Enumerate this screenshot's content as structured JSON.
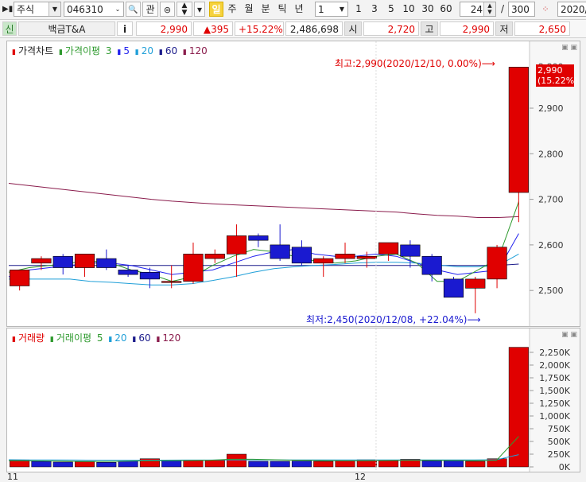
{
  "toolbar": {
    "market_type": "주식",
    "stock_code": "046310",
    "search_button": "🔍",
    "related_button": "관",
    "period_buttons": [
      "일",
      "주",
      "월",
      "분",
      "틱",
      "년"
    ],
    "selected_period": "일",
    "interval_value": "1",
    "quick_intervals": [
      "1",
      "3",
      "5",
      "10",
      "30",
      "60"
    ],
    "display_count": "24",
    "separator": "/",
    "total_count": "300",
    "date_field": "2020/"
  },
  "info": {
    "credit_badge": "신",
    "stock_name": "백금T&A",
    "info_button": "i",
    "current_price": "2,990",
    "change": "▲395",
    "change_rate": "+15.22%",
    "volume": "2,486,698",
    "open_label": "시",
    "open_value": "2,720",
    "high_label": "고",
    "high_value": "2,990",
    "low_label": "저",
    "low_value": "2,650"
  },
  "price_panel": {
    "legend_title": "가격차트",
    "legend_ma_title": "가격이평",
    "legend_periods": [
      "3",
      "5",
      "20",
      "60",
      "120"
    ],
    "high_annotation": "최고:2,990(2020/12/10, 0.00%)⟶",
    "low_annotation": "최저:2,450(2020/12/08, +22.04%)⟶",
    "current_tag_price": "2,990",
    "current_tag_rate": "(15.22%)",
    "y_ticks": [
      "2,800",
      "2,900",
      "2,800",
      "2,700",
      "2,600",
      "2,500"
    ]
  },
  "volume_panel": {
    "legend_title": "거래량",
    "legend_ma_title": "거래이평",
    "legend_periods": [
      "5",
      "20",
      "60",
      "120"
    ],
    "y_ticks": [
      "2,250K",
      "2,000K",
      "1,750K",
      "1,500K",
      "1,250K",
      "1,000K",
      "750K",
      "500K",
      "250K",
      "0K"
    ]
  },
  "x_labels": [
    "11",
    "12"
  ],
  "colors": {
    "up": "#e00000",
    "down": "#1a1ad0",
    "ma3": "#2e9a2e",
    "ma5": "#2222ee",
    "ma20": "#1f9fd8",
    "ma60": "#1a1a8a",
    "ma120": "#8a1c4c"
  },
  "chart_data": {
    "type": "candlestick",
    "price": {
      "ylim": [
        2450,
        3000
      ],
      "candles": [
        {
          "o": 2510,
          "h": 2545,
          "l": 2500,
          "c": 2545
        },
        {
          "o": 2560,
          "h": 2575,
          "l": 2545,
          "c": 2570
        },
        {
          "o": 2575,
          "h": 2580,
          "l": 2535,
          "c": 2550
        },
        {
          "o": 2550,
          "h": 2575,
          "l": 2530,
          "c": 2580
        },
        {
          "o": 2570,
          "h": 2590,
          "l": 2545,
          "c": 2550
        },
        {
          "o": 2545,
          "h": 2555,
          "l": 2530,
          "c": 2535
        },
        {
          "o": 2540,
          "h": 2550,
          "l": 2505,
          "c": 2525
        },
        {
          "o": 2520,
          "h": 2555,
          "l": 2505,
          "c": 2520
        },
        {
          "o": 2520,
          "h": 2605,
          "l": 2515,
          "c": 2580
        },
        {
          "o": 2570,
          "h": 2590,
          "l": 2560,
          "c": 2580
        },
        {
          "o": 2580,
          "h": 2645,
          "l": 2530,
          "c": 2620
        },
        {
          "o": 2620,
          "h": 2625,
          "l": 2595,
          "c": 2610
        },
        {
          "o": 2600,
          "h": 2645,
          "l": 2565,
          "c": 2570
        },
        {
          "o": 2595,
          "h": 2610,
          "l": 2555,
          "c": 2560
        },
        {
          "o": 2560,
          "h": 2575,
          "l": 2530,
          "c": 2570
        },
        {
          "o": 2570,
          "h": 2605,
          "l": 2560,
          "c": 2580
        },
        {
          "o": 2570,
          "h": 2585,
          "l": 2550,
          "c": 2575
        },
        {
          "o": 2580,
          "h": 2605,
          "l": 2565,
          "c": 2605
        },
        {
          "o": 2600,
          "h": 2610,
          "l": 2550,
          "c": 2575
        },
        {
          "o": 2575,
          "h": 2580,
          "l": 2520,
          "c": 2535
        },
        {
          "o": 2525,
          "h": 2530,
          "l": 2490,
          "c": 2485
        },
        {
          "o": 2505,
          "h": 2530,
          "l": 2450,
          "c": 2525
        },
        {
          "o": 2525,
          "h": 2600,
          "l": 2505,
          "c": 2595
        },
        {
          "o": 2715,
          "h": 2990,
          "l": 2650,
          "c": 2990
        }
      ],
      "ma3": [
        2540,
        2550,
        2555,
        2560,
        2565,
        2560,
        2545,
        2535,
        2520,
        2530,
        2555,
        2575,
        2590,
        2585,
        2575,
        2565,
        2560,
        2565,
        2575,
        2580,
        2560,
        2520,
        2520,
        2545,
        2570,
        2695
      ],
      "ma5": [
        2530,
        2545,
        2550,
        2555,
        2560,
        2560,
        2555,
        2545,
        2535,
        2540,
        2545,
        2560,
        2575,
        2585,
        2590,
        2580,
        2575,
        2575,
        2580,
        2575,
        2560,
        2545,
        2535,
        2540,
        2545,
        2625
      ],
      "ma20": [
        2525,
        2525,
        2525,
        2525,
        2520,
        2518,
        2515,
        2512,
        2512,
        2515,
        2522,
        2530,
        2540,
        2548,
        2552,
        2555,
        2557,
        2560,
        2562,
        2562,
        2560,
        2556,
        2552,
        2552,
        2555,
        2580
      ],
      "ma60": [
        2555,
        2555,
        2555,
        2555,
        2555,
        2555,
        2555,
        2555,
        2555,
        2555,
        2555,
        2555,
        2555,
        2555,
        2555,
        2555,
        2555,
        2555,
        2555,
        2555,
        2555,
        2555,
        2555,
        2555,
        2555,
        2558
      ],
      "ma120": [
        2735,
        2730,
        2725,
        2720,
        2715,
        2710,
        2705,
        2700,
        2696,
        2693,
        2690,
        2688,
        2686,
        2684,
        2682,
        2680,
        2678,
        2676,
        2674,
        2672,
        2668,
        2665,
        2663,
        2660,
        2660,
        2662
      ]
    },
    "volume": {
      "ylim": [
        0,
        2400000
      ],
      "values": [
        130000,
        110000,
        95000,
        100000,
        90000,
        115000,
        160000,
        120000,
        135000,
        130000,
        250000,
        110000,
        110000,
        115000,
        110000,
        120000,
        140000,
        125000,
        150000,
        120000,
        120000,
        110000,
        160000,
        2350000
      ],
      "up": [
        true,
        false,
        false,
        true,
        false,
        false,
        true,
        false,
        true,
        true,
        true,
        false,
        false,
        false,
        true,
        true,
        true,
        true,
        true,
        false,
        false,
        true,
        true,
        true
      ],
      "ma5": [
        120000,
        118000,
        115000,
        110000,
        108000,
        110000,
        118000,
        120000,
        125000,
        130000,
        150000,
        150000,
        140000,
        130000,
        125000,
        120000,
        122000,
        125000,
        130000,
        128000,
        125000,
        125000,
        130000,
        600000
      ],
      "ma20": [
        140000,
        138000,
        136000,
        134000,
        132000,
        132000,
        132000,
        133000,
        134000,
        135000,
        138000,
        138000,
        138000,
        137000,
        136000,
        136000,
        136000,
        137000,
        138000,
        138000,
        138000,
        137000,
        140000,
        240000
      ]
    }
  }
}
